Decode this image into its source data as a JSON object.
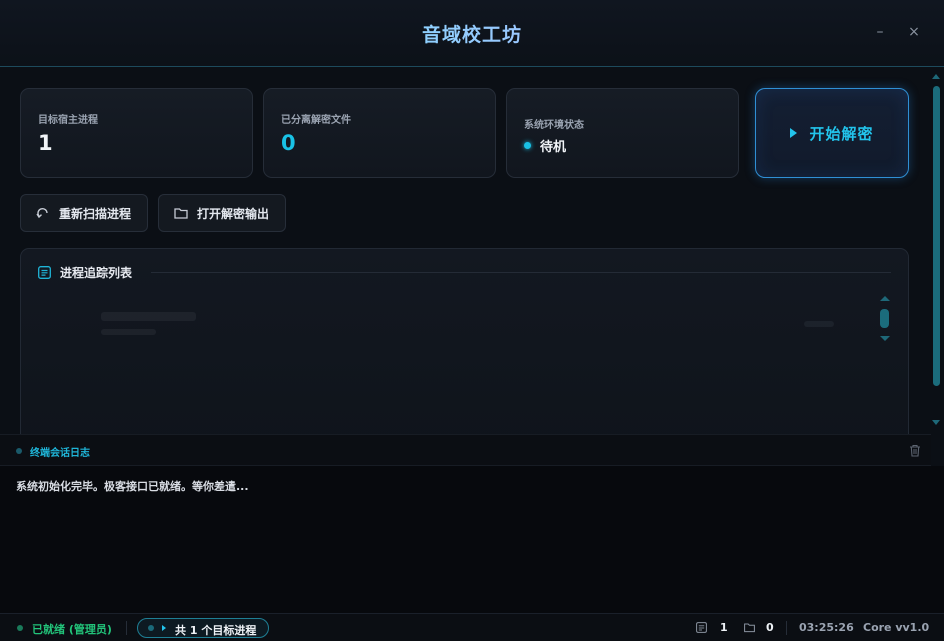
{
  "window": {
    "title": "音域校工坊",
    "minimize_glyph": "–",
    "close_glyph": "×"
  },
  "stats": {
    "host_processes": {
      "label": "目标宿主进程",
      "value": "1"
    },
    "decrypted_files": {
      "label": "已分离解密文件",
      "value": "0"
    },
    "env_status": {
      "label": "系统环境状态",
      "value": "待机"
    }
  },
  "actions": {
    "start_label": "开始解密",
    "rescan_label": "重新扫描进程",
    "open_output_label": "打开解密输出"
  },
  "process_panel": {
    "title": "进程追踪列表"
  },
  "log": {
    "title": "终端会话日志",
    "lines": [
      "系统初始化完毕。极客接口已就绪。等你差遣..."
    ]
  },
  "statusbar": {
    "ready": "已就绪 (管理员)",
    "target_count": "共 1 个目标进程",
    "files_count": "1",
    "folders_count": "0",
    "time": "03:25:26",
    "version": "Core vv1.0"
  },
  "colors": {
    "accent": "#19c2e6",
    "ready_green": "#22c47a",
    "background": "#0b0f15"
  },
  "icons": [
    "refresh-icon",
    "folder-icon",
    "list-icon",
    "trash-icon",
    "play-icon",
    "file-icon"
  ]
}
